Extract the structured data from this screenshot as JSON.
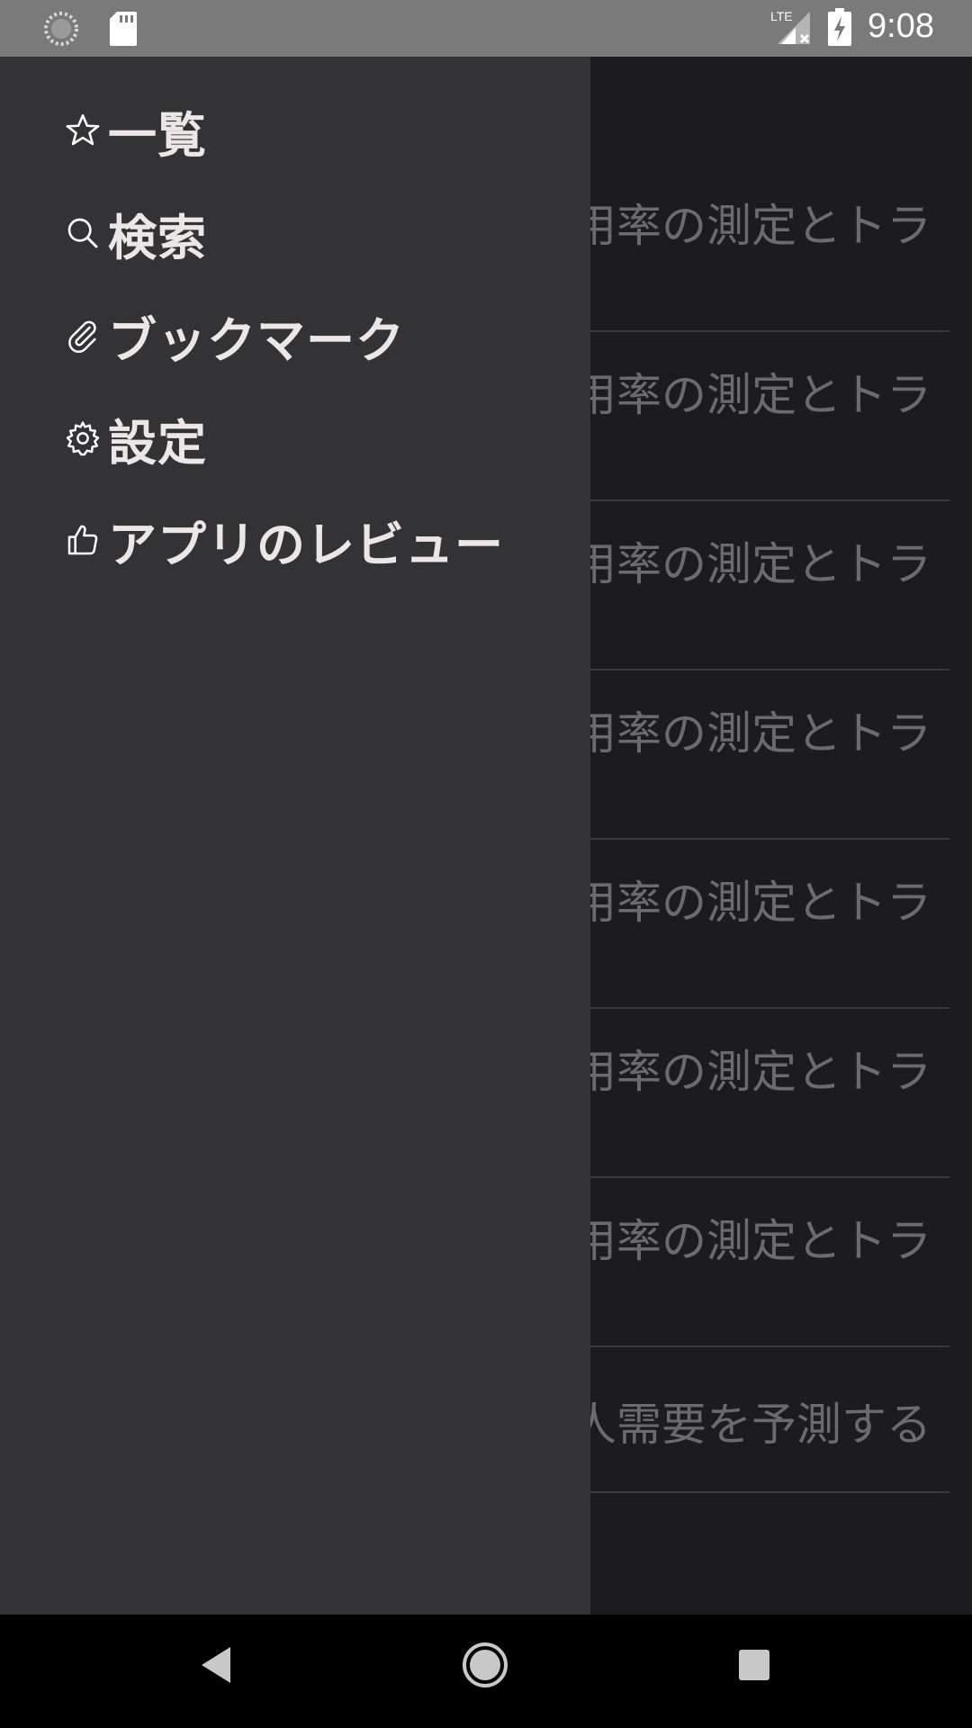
{
  "status_bar": {
    "time": "9:08",
    "network": "LTE",
    "icons": [
      "loading-icon",
      "sd-card-icon",
      "signal-icon",
      "battery-charging-icon"
    ]
  },
  "drawer": {
    "items": [
      {
        "icon": "star-icon",
        "label": "一覧"
      },
      {
        "icon": "search-icon",
        "label": "検索"
      },
      {
        "icon": "paperclip-icon",
        "label": "ブックマーク"
      },
      {
        "icon": "gear-icon",
        "label": "設定"
      },
      {
        "icon": "thumbs-up-icon",
        "label": "アプリのレビュー"
      }
    ]
  },
  "background_list": {
    "items": [
      "用率の測定とトラ",
      "用率の測定とトラ",
      "用率の測定とトラ",
      "用率の測定とトラ",
      "用率の測定とトラ",
      "用率の測定とトラ",
      "用率の測定とトラ",
      "人需要を予測する"
    ]
  },
  "colors": {
    "drawer_bg": "#333336",
    "scrim_bg": "#1c1c1e",
    "menu_text": "#ece6e6",
    "list_text": "#6b6b6d"
  }
}
